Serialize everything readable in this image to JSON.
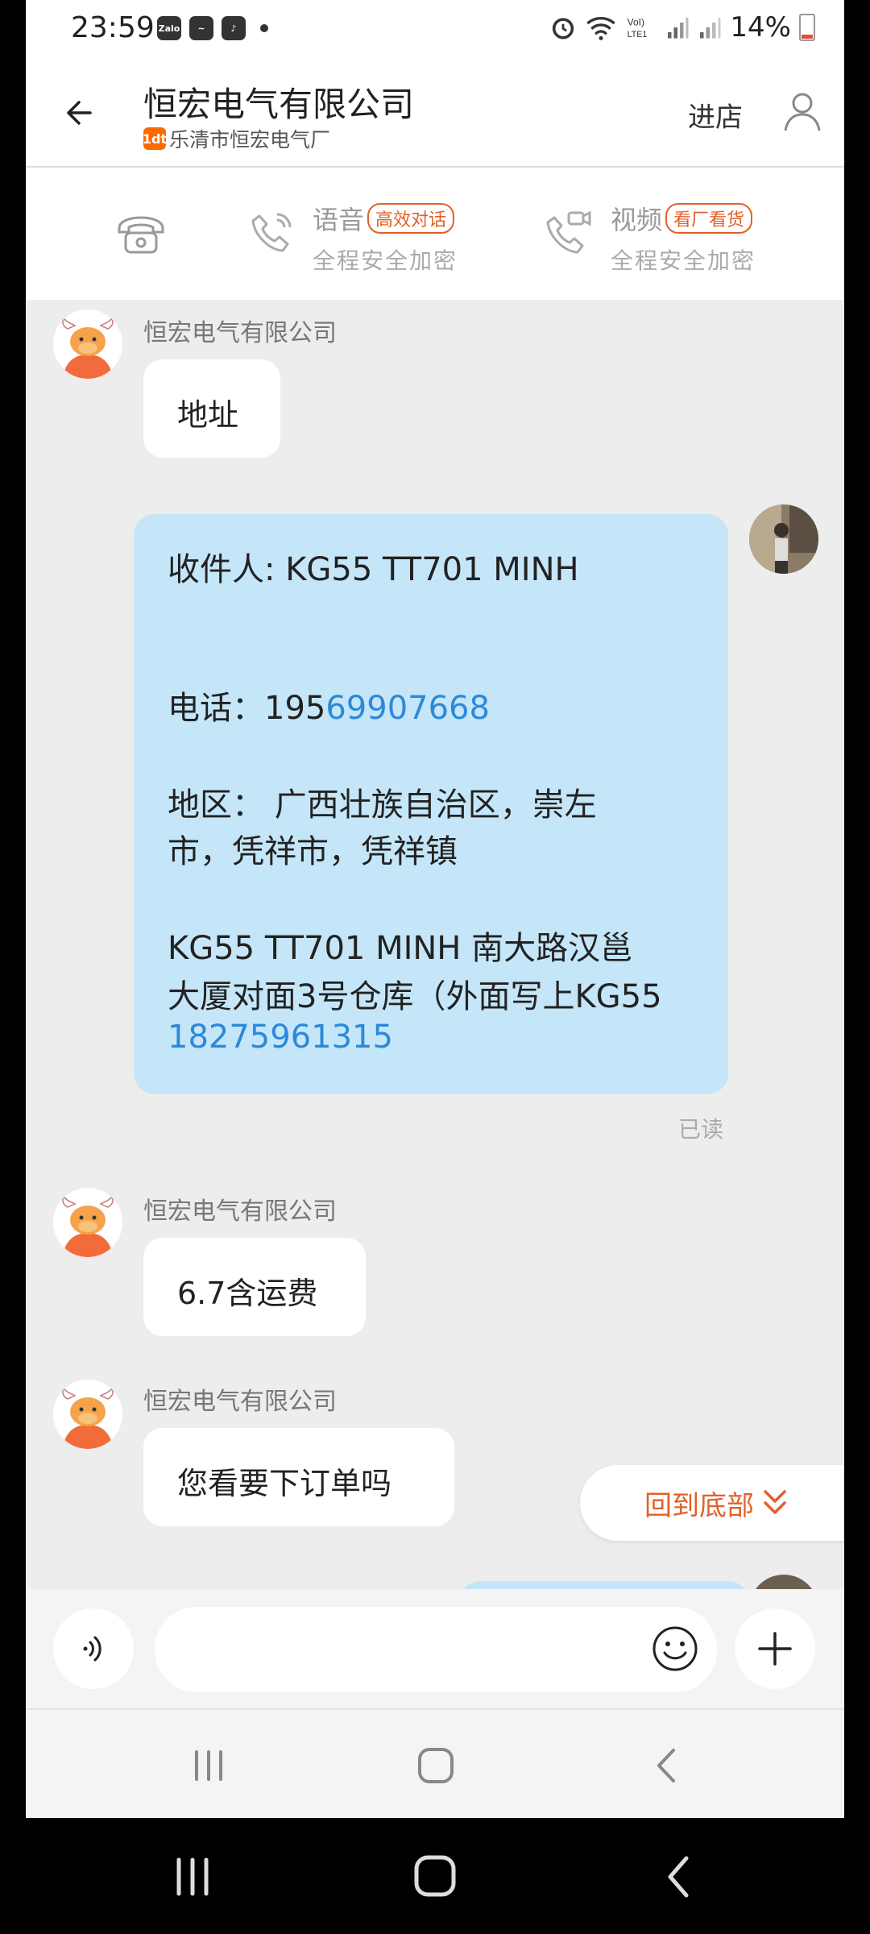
{
  "status_bar": {
    "time": "23:59",
    "app_icons": [
      "Zalo",
      "wing",
      "tiktok"
    ],
    "battery": "14%"
  },
  "header": {
    "title": "恒宏电气有限公司",
    "subtitle": "乐清市恒宏电气厂",
    "shop_badge": "1dt",
    "enter_shop": "进店"
  },
  "call_bar": {
    "voice": {
      "label": "语音",
      "tag": "高效对话",
      "sub": "全程安全加密"
    },
    "video": {
      "label": "视频",
      "tag": "看厂看货",
      "sub": "全程安全加密"
    }
  },
  "messages": {
    "m1": {
      "sender": "恒宏电气有限公司",
      "text": "地址"
    },
    "mine": {
      "line1": "收件人: KG55 TT701 MINH",
      "phone_prefix": "电话：195",
      "phone_link": "69907668",
      "region1": "地区： 广西壮族自治区，崇左",
      "region2": "市，凭祥市，凭祥镇",
      "addr1": "KG55 TT701 MINH  南大路汉邕",
      "addr2": "大厦对面3号仓库（外面写上KG55",
      "addr3": "18275961315",
      "read": "已读"
    },
    "m2": {
      "sender": "恒宏电气有限公司",
      "text": "6.7含运费"
    },
    "m3": {
      "sender": "恒宏电气有限公司",
      "text": "您看要下订单吗"
    }
  },
  "scroll_to_bottom": "回到底部",
  "colors": {
    "accent": "#e2602a",
    "my_bubble": "#c5e6f8",
    "link": "#2d89d8"
  }
}
